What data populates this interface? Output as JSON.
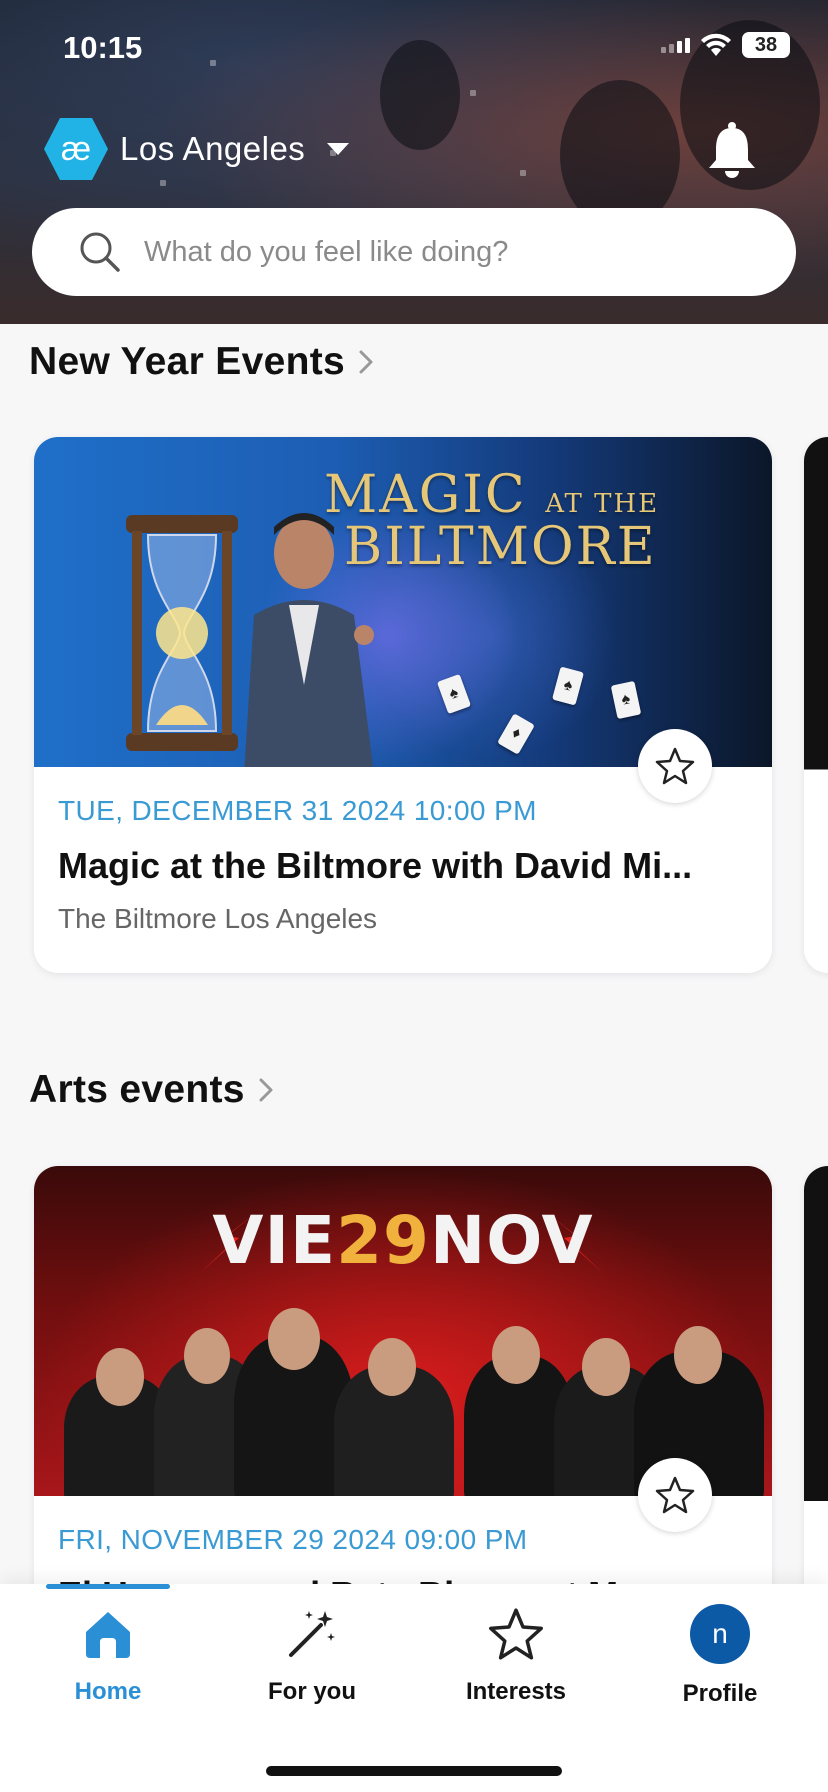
{
  "status_bar": {
    "time": "10:15",
    "battery": "38"
  },
  "header": {
    "logo_text": "æ",
    "city": "Los Angeles",
    "search_placeholder": "What do you feel like doing?"
  },
  "sections": [
    {
      "title": "New Year Events",
      "card": {
        "image_title_line1": "MAGIC",
        "image_title_small": "AT THE",
        "image_title_line2": "BILTMORE",
        "date": "TUE, DECEMBER 31 2024 10:00 PM",
        "title": "Magic at the Biltmore with David Mi...",
        "venue": "The Biltmore Los Angeles"
      }
    },
    {
      "title": "Arts events",
      "card": {
        "banner_left": "VIE",
        "banner_num": "29",
        "banner_right": "NOV",
        "date": "FRI, NOVEMBER 29 2024 09:00 PM",
        "title": "El Haragan and Rata Blanca at M..."
      }
    }
  ],
  "tabs": [
    {
      "label": "Home",
      "icon": "home-icon",
      "active": true
    },
    {
      "label": "For you",
      "icon": "magic-wand-icon",
      "active": false
    },
    {
      "label": "Interests",
      "icon": "star-icon",
      "active": false
    },
    {
      "label": "Profile",
      "icon": "avatar",
      "avatar_letter": "n",
      "active": false
    }
  ],
  "colors": {
    "accent": "#2b8fd6",
    "date_text": "#3a9ad3",
    "logo": "#22b3e6",
    "avatar": "#0c5aa6"
  }
}
